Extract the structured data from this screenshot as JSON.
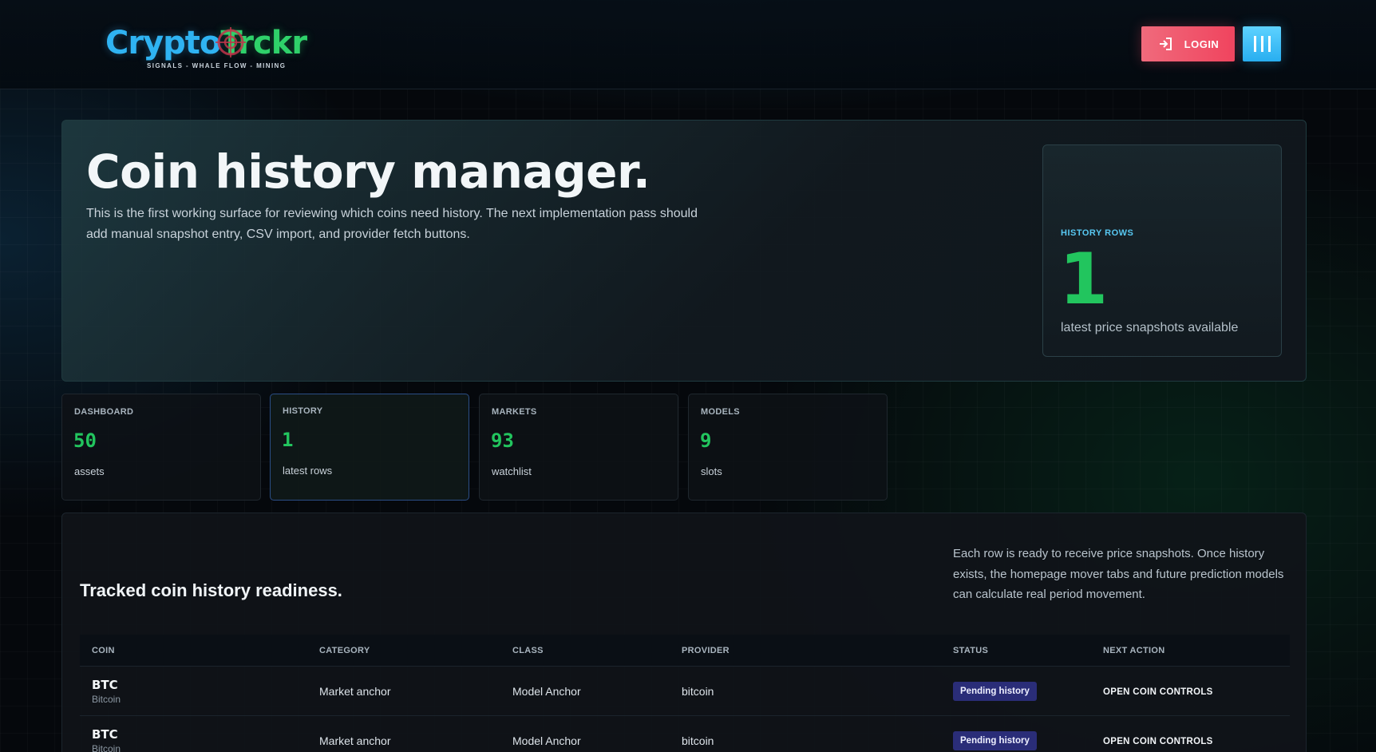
{
  "header": {
    "logo": {
      "part1": "Crypto",
      "part2": "Trckr",
      "tagline": "SIGNALS - WHALE FLOW - MINING"
    },
    "login_label": "LOGIN",
    "icons": {
      "login": "login-icon",
      "menu": "menu-icon",
      "logo_target": "target-icon"
    }
  },
  "hero": {
    "title": "Coin history manager.",
    "description": "This is the first working surface for reviewing which coins need history. The next implementation pass should add manual snapshot entry, CSV import, and provider fetch buttons.",
    "stat": {
      "label": "HISTORY ROWS",
      "value": "1",
      "sub": "latest price snapshots available"
    }
  },
  "cards": [
    {
      "label": "DASHBOARD",
      "value": "50",
      "sub": "assets"
    },
    {
      "label": "HISTORY",
      "value": "1",
      "sub": "latest rows"
    },
    {
      "label": "MARKETS",
      "value": "93",
      "sub": "watchlist"
    },
    {
      "label": "MODELS",
      "value": "9",
      "sub": "slots"
    }
  ],
  "panel": {
    "title": "Tracked coin history readiness.",
    "description": "Each row is ready to receive price snapshots. Once history exists, the homepage mover tabs and future prediction models can calculate real period movement.",
    "columns": [
      "COIN",
      "CATEGORY",
      "CLASS",
      "PROVIDER",
      "STATUS",
      "NEXT ACTION"
    ],
    "rows": [
      {
        "symbol": "BTC",
        "name": "Bitcoin",
        "category": "Market anchor",
        "class": "Model Anchor",
        "provider": "bitcoin",
        "status": "Pending history",
        "action": "OPEN COIN CONTROLS"
      },
      {
        "symbol": "BTC",
        "name": "Bitcoin",
        "category": "Market anchor",
        "class": "Model Anchor",
        "provider": "bitcoin",
        "status": "Pending history",
        "action": "OPEN COIN CONTROLS"
      }
    ]
  },
  "colors": {
    "accent_green": "#22c55e",
    "accent_blue": "#2fb3f2",
    "login_red": "#f0445e",
    "badge_indigo": "#2a2d78"
  }
}
